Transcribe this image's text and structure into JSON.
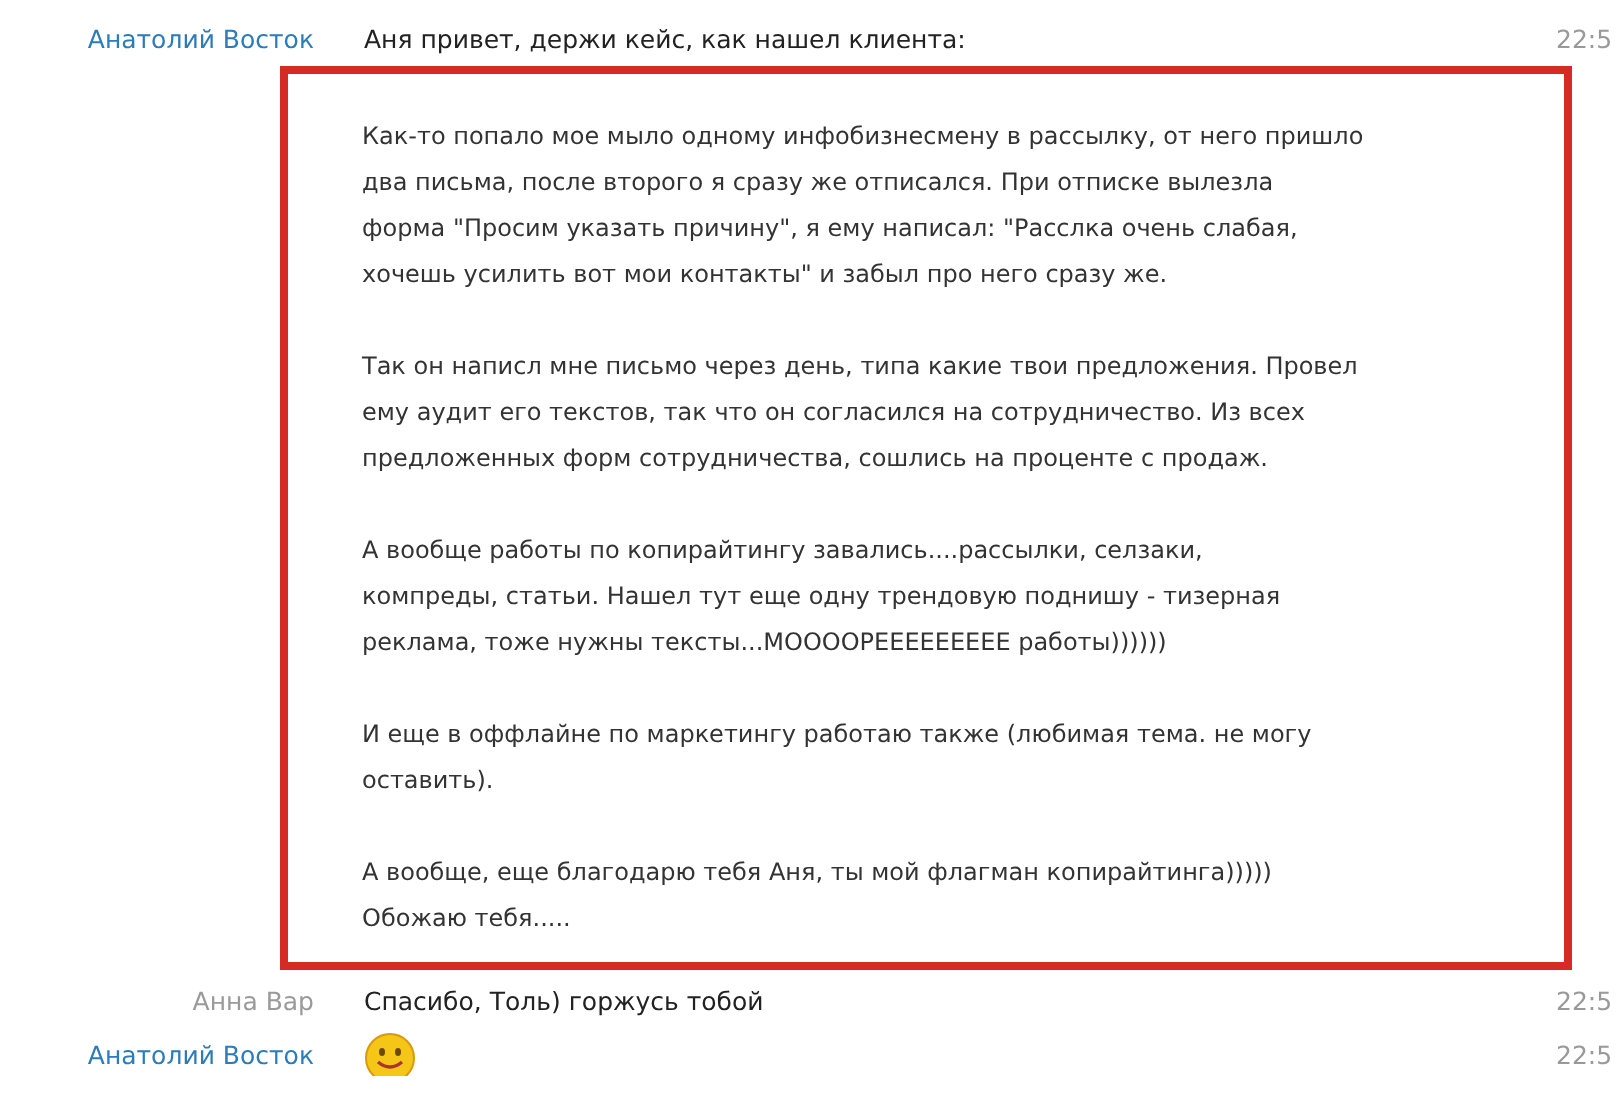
{
  "messages": [
    {
      "kind": "text",
      "sender": "Анатолий Восток",
      "color": "#2b7cb9",
      "text": "Аня привет, держи кейс, как нашел клиента:",
      "time": "22:5",
      "highlight": {
        "paragraphs": [
          "Как-то попало мое мыло одному инфобизнесмену в рассылку, от него пришло\nдва письма, после второго я сразу же отписался. При отписке вылезла\nформа \"Просим указать причину\", я ему написал: \"Расслка очень слабая,\nхочешь усилить вот мои контакты\" и забыл про него сразу же.",
          "Так он написл мне письмо через день, типа какие твои предложения. Провел\nему аудит его текстов, так что он согласился на сотрудничество. Из всех\nпредложенных форм сотрудничества, сошлись на проценте с продаж.",
          "А вообще работы по копирайтингу завались....рассылки, селзаки,\nкомпреды, статьи. Нашел тут еще одну трендовую поднишу - тизерная\nреклама, тоже нужны тексты...МООООРЕЕЕЕЕЕЕЕЕ работы))))))",
          "И еще в оффлайне по маркетингу работаю также (любимая тема. не могу\nоставить).",
          "А вообще, еще благодарю тебя Аня, ты мой флагман копирайтинга)))))\nОбожаю тебя....."
        ]
      }
    },
    {
      "kind": "text",
      "sender": "Анна Вар",
      "color": "#9a9a9a",
      "text": "Спасибо, Толь) горжусь тобой",
      "time": "22:5"
    },
    {
      "kind": "emoji",
      "sender": "Анатолий Восток",
      "color": "#2b7cb9",
      "time": "22:5"
    }
  ]
}
